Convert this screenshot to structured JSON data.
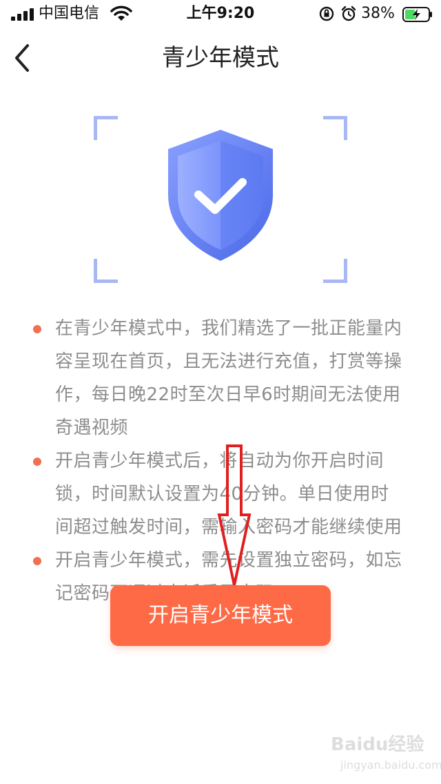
{
  "status_bar": {
    "carrier": "中国电信",
    "time": "上午9:20",
    "battery_percent": "38%",
    "icons": [
      "signal-icon",
      "wifi-icon",
      "rotation-lock-icon",
      "alarm-icon",
      "battery-charging-icon"
    ]
  },
  "nav": {
    "title": "青少年模式",
    "back_icon": "chevron-left-icon"
  },
  "hero": {
    "icon": "shield-check-icon",
    "colors": {
      "shield": "#5b7cf0",
      "corner": "#a9b8f5"
    }
  },
  "info_items": [
    "在青少年模式中，我们精选了一批正能量内容呈现在首页，且无法进行充值，打赏等操作，每日晚22时至次日早6时期间无法使用奇遇视频",
    "开启青少年模式后，将自动为你开启时间锁，时间默认设置为40分钟。单日使用时间超过触发时间，需输入密码才能继续使用",
    "开启青少年模式，需先设置独立密码，如忘记密码可通过申诉重置密码"
  ],
  "primary_button": {
    "label": "开启青少年模式",
    "color": "#fe6a45"
  },
  "annotation": {
    "icon": "down-arrow-annotation",
    "color": "#e02020"
  },
  "watermark": {
    "brand": "Baidu经验",
    "sub": "jingyan.baidu.com"
  }
}
